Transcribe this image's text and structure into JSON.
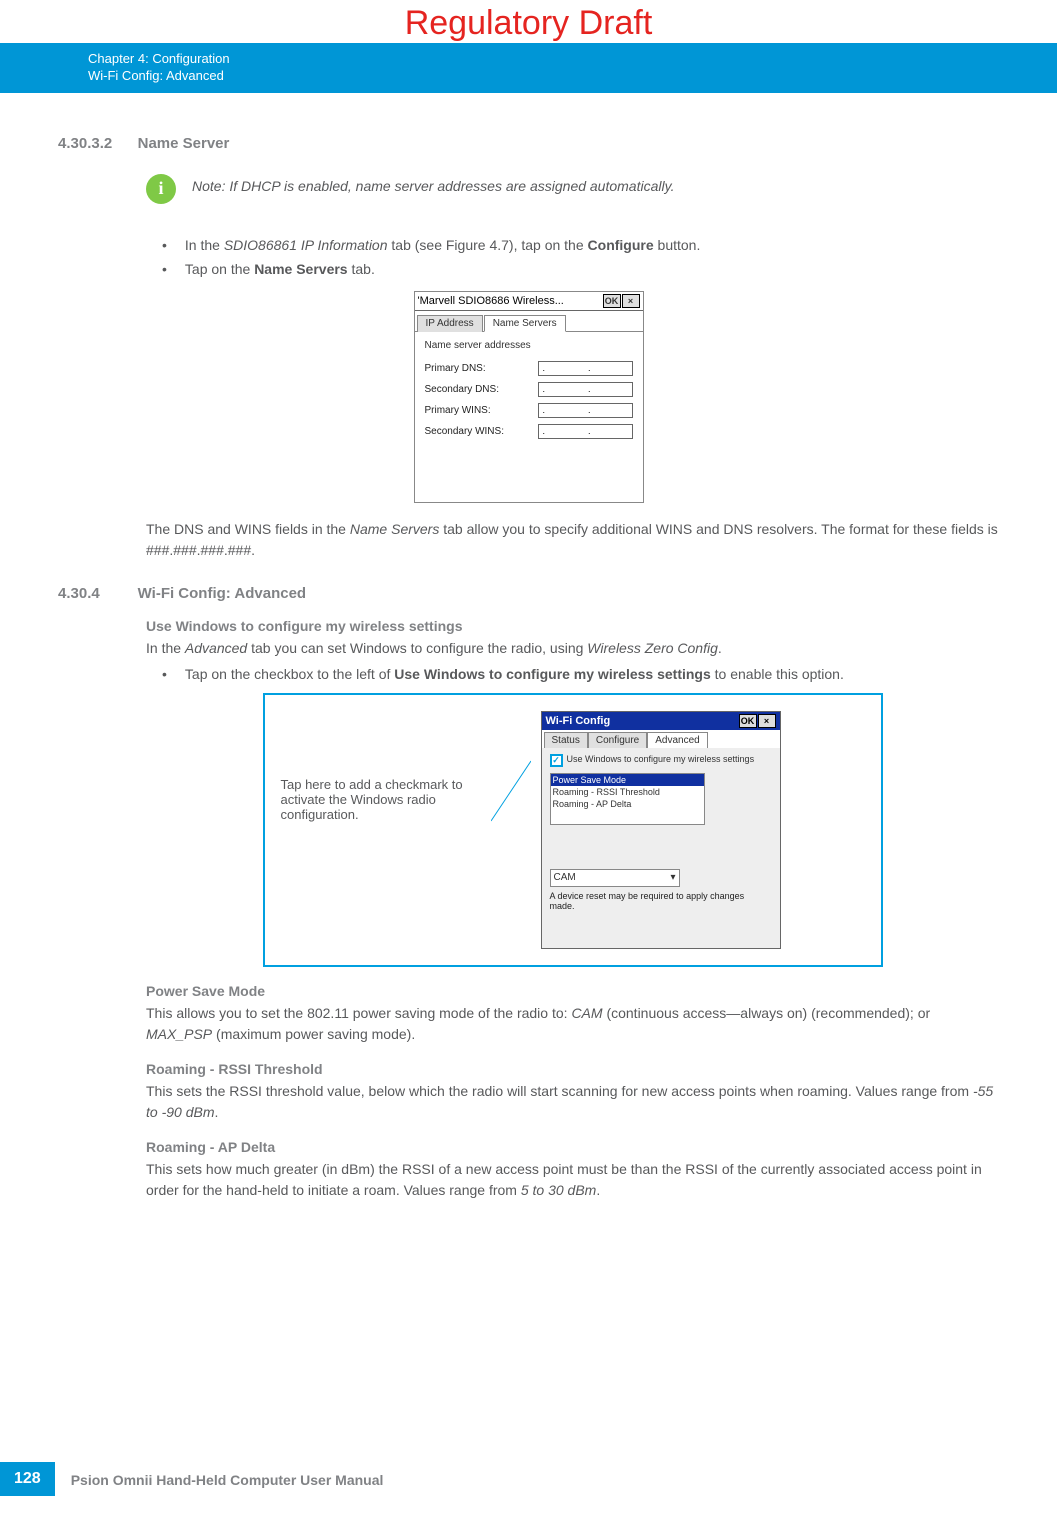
{
  "banner": "Regulatory Draft",
  "header": {
    "line1": "Chapter 4:  Configuration",
    "line2": "Wi-Fi Config: Advanced"
  },
  "sec1": {
    "num": "4.30.3.2",
    "title": "Name Server",
    "note": "Note:  If DHCP is enabled, name server addresses are assigned automatically.",
    "b1_a": "In the ",
    "b1_b": "SDIO86861 IP Information",
    "b1_c": " tab (see Figure 4.7), tap on the ",
    "b1_d": "Configure",
    "b1_e": " button.",
    "b2_a": "Tap on the ",
    "b2_b": "Name Servers",
    "b2_c": " tab.",
    "para_a": "The DNS and WINS fields in the ",
    "para_b": "Name Servers",
    "para_c": " tab allow you to specify additional WINS and DNS resolvers. The format for these fields is ###.###.###.###."
  },
  "fig1": {
    "title": "'Marvell SDIO8686 Wireless...",
    "ok": "OK",
    "close": "×",
    "tab1": "IP Address",
    "tab2": "Name Servers",
    "caption": "Name server addresses",
    "r1": "Primary DNS:",
    "r2": "Secondary DNS:",
    "r3": "Primary WINS:",
    "r4": "Secondary WINS:",
    "dots": ".      .      ."
  },
  "sec2": {
    "num": "4.30.4",
    "title": "Wi-Fi Config: Advanced",
    "sub1": "Use Windows to configure my wireless settings",
    "p1_a": "In the ",
    "p1_b": "Advanced",
    "p1_c": " tab you can set Windows to configure the radio, using ",
    "p1_d": "Wireless Zero Config",
    "p1_e": ".",
    "b1_a": "Tap on the checkbox to the left of ",
    "b1_b": "Use Windows to configure my wireless settings",
    "b1_c": " to enable this option.",
    "annot": "Tap here to add a checkmark to activate the Windows radio configuration.",
    "sub2": "Power Save Mode",
    "p2_a": "This allows you to set the 802.11 power saving mode of the radio to: ",
    "p2_b": "CAM",
    "p2_c": " (continuous access—always on) (recommended); or ",
    "p2_d": "MAX_PSP",
    "p2_e": " (maximum power saving mode).",
    "sub3": "Roaming - RSSI Threshold",
    "p3_a": "This sets the RSSI threshold value, below which the radio will start scanning for new access points when roaming. Values range from ",
    "p3_b": "-55 to -90 dBm",
    "p3_c": ".",
    "sub4": "Roaming - AP Delta",
    "p4_a": "This sets how much greater (in dBm) the RSSI of a new access point must be than the RSSI of the currently associated access point in order for the hand-held to initiate a roam. Values range from ",
    "p4_b": "5 to 30 dBm",
    "p4_c": "."
  },
  "fig2": {
    "title": "Wi-Fi Config",
    "ok": "OK",
    "close": "×",
    "tab1": "Status",
    "tab2": "Configure",
    "tab3": "Advanced",
    "chk": "✓",
    "chk_label": "Use Windows to configure my wireless settings",
    "list1": "Power Save Mode",
    "list2": "Roaming - RSSI Threshold",
    "list3": "Roaming - AP Delta",
    "select": "CAM",
    "reset": "A device reset may be required to apply changes made."
  },
  "footer": {
    "page": "128",
    "manual": "Psion Omnii Hand-Held Computer User Manual"
  }
}
